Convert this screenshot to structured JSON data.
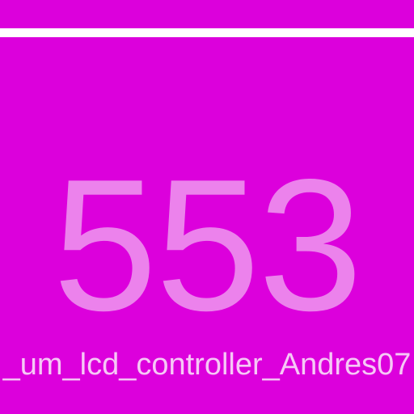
{
  "display": {
    "value": "553",
    "label": "_um_lcd_controller_Andres07"
  },
  "colors": {
    "background": "#dc00dc",
    "top_bar": "#ffffff",
    "value_text": "#ec82ec",
    "label_text": "#f6c8f6"
  }
}
